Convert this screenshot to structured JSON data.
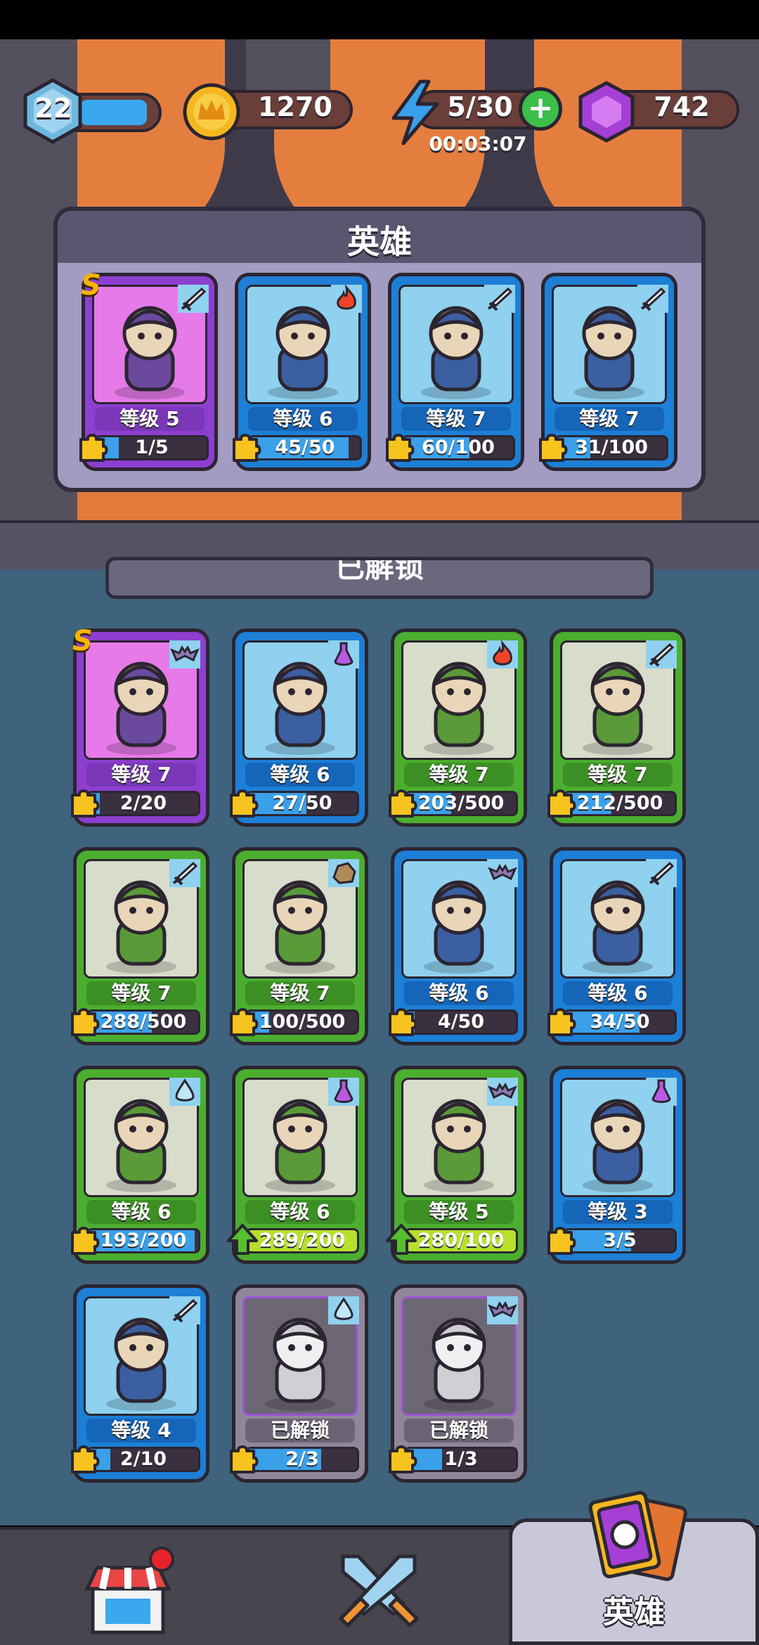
{
  "hud": {
    "player_level": "22",
    "xp_fill": 0.85,
    "gold": "1270",
    "energy": "5/30",
    "energy_timer": "00:03:07",
    "gems": "742"
  },
  "heroes_panel": {
    "title": "英雄",
    "cards": [
      {
        "rarity": "S",
        "color": "purple",
        "element": "sword-icon",
        "level": "等级 5",
        "progress": "1/5",
        "fill": 0.2,
        "portrait": "goblin-crown-hero"
      },
      {
        "rarity": "",
        "color": "blue",
        "element": "fire-icon",
        "level": "等级 6",
        "progress": "45/50",
        "fill": 0.9,
        "portrait": "anubis-bird-hero"
      },
      {
        "rarity": "",
        "color": "blue",
        "element": "sword-icon",
        "level": "等级 7",
        "progress": "60/100",
        "fill": 0.6,
        "portrait": "horned-knight-hero"
      },
      {
        "rarity": "",
        "color": "blue",
        "element": "sword-icon",
        "level": "等级 7",
        "progress": "31/100",
        "fill": 0.31,
        "portrait": "skeleton-viking-hero"
      }
    ]
  },
  "unlocked_section": {
    "header": "已解锁",
    "cards": [
      {
        "rarity": "S",
        "color": "purple",
        "element": "bat-icon",
        "level": "等级 7",
        "progress": "2/20",
        "fill": 0.1,
        "portrait": "vampire-lord",
        "upgrade": false
      },
      {
        "rarity": "",
        "color": "blue",
        "element": "potion-icon",
        "level": "等级 6",
        "progress": "27/50",
        "fill": 0.54,
        "portrait": "stone-golem",
        "upgrade": false
      },
      {
        "rarity": "",
        "color": "green",
        "element": "fire-icon",
        "level": "等级 7",
        "progress": "203/500",
        "fill": 0.41,
        "portrait": "winged-eye",
        "upgrade": false
      },
      {
        "rarity": "",
        "color": "green",
        "element": "sword-icon",
        "level": "等级 7",
        "progress": "212/500",
        "fill": 0.42,
        "portrait": "leaf-dragon",
        "upgrade": false
      },
      {
        "rarity": "",
        "color": "green",
        "element": "sword-icon",
        "level": "等级 7",
        "progress": "288/500",
        "fill": 0.58,
        "portrait": "green-crown-knight",
        "upgrade": false
      },
      {
        "rarity": "",
        "color": "green",
        "element": "rock-icon",
        "level": "等级 7",
        "progress": "100/500",
        "fill": 0.2,
        "portrait": "ogre-throne",
        "upgrade": false
      },
      {
        "rarity": "",
        "color": "blue",
        "element": "bat-icon",
        "level": "等级 6",
        "progress": "4/50",
        "fill": 0.08,
        "portrait": "dark-fairy",
        "upgrade": false
      },
      {
        "rarity": "",
        "color": "blue",
        "element": "sword-icon",
        "level": "等级 6",
        "progress": "34/50",
        "fill": 0.68,
        "portrait": "monkey-chief",
        "upgrade": false
      },
      {
        "rarity": "",
        "color": "green",
        "element": "water-icon",
        "level": "等级 6",
        "progress": "193/200",
        "fill": 0.965,
        "portrait": "blue-shaman",
        "upgrade": false
      },
      {
        "rarity": "",
        "color": "green",
        "element": "potion-icon",
        "level": "等级 6",
        "progress": "289/200",
        "fill": 1,
        "portrait": "pharaoh",
        "upgrade": true
      },
      {
        "rarity": "",
        "color": "green",
        "element": "bat-icon",
        "level": "等级 5",
        "progress": "280/100",
        "fill": 1,
        "portrait": "witch-reaper",
        "upgrade": true
      },
      {
        "rarity": "",
        "color": "blue",
        "element": "potion-icon",
        "level": "等级 3",
        "progress": "3/5",
        "fill": 0.6,
        "portrait": "horned-imp",
        "upgrade": false
      },
      {
        "rarity": "",
        "color": "blue",
        "element": "sword-icon",
        "level": "等级 4",
        "progress": "2/10",
        "fill": 0.2,
        "portrait": "green-troll",
        "upgrade": false
      },
      {
        "rarity": "",
        "color": "gray",
        "element": "water-icon",
        "level": "已解锁",
        "progress": "2/3",
        "fill": 0.67,
        "portrait": "locked-knight",
        "upgrade": false
      },
      {
        "rarity": "",
        "color": "gray",
        "element": "bat-icon",
        "level": "已解锁",
        "progress": "1/3",
        "fill": 0.33,
        "portrait": "locked-wraith",
        "upgrade": false
      }
    ]
  },
  "nav": {
    "shop_icon": "shop-icon",
    "battle_icon": "crossed-swords-icon",
    "heroes_label": "英雄"
  }
}
